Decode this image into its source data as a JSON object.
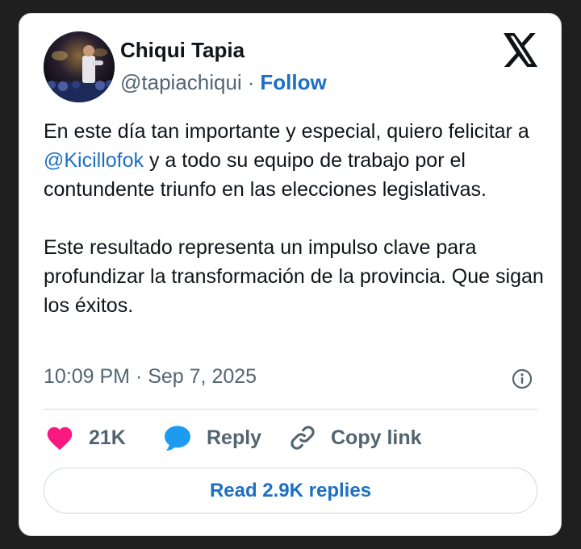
{
  "author": {
    "name": "Chiqui Tapia",
    "handle": "@tapiachiqui",
    "separator": "·",
    "follow_label": "Follow"
  },
  "tweet": {
    "paragraph1": {
      "before": "En este día tan importante y especial, quiero felicitar a ",
      "mention": "@Kicillofok",
      "after": " y a todo su equipo de trabajo por el contundente triunfo en las elecciones legislativas."
    },
    "paragraph2": "Este resultado representa un impulso clave para profundizar la transformación de la provincia. Que sigan los éxitos.",
    "timestamp": "10:09 PM · Sep 7, 2025"
  },
  "actions": {
    "likes_count": "21K",
    "reply_label": "Reply",
    "copy_link_label": "Copy link"
  },
  "read_replies_label": "Read 2.9K replies",
  "icons": {
    "like": "heart-icon",
    "reply": "speech-bubble-icon",
    "copy_link": "link-icon",
    "info": "info-icon",
    "logo": "x-logo-icon"
  },
  "colors": {
    "link_blue": "#1d6fc4",
    "like_pink": "#f91880",
    "reply_blue": "#1d9bf0",
    "text_primary": "#0f1419",
    "text_secondary": "#536471",
    "border": "#cfd9de",
    "background": "#1f1f1f"
  }
}
